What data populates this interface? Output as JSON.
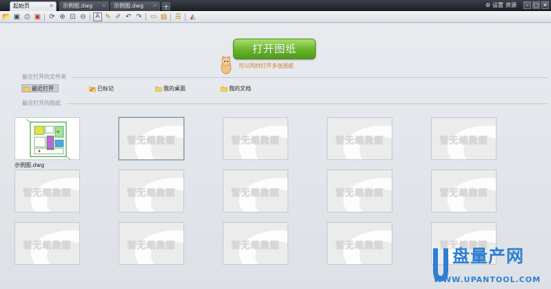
{
  "tabs": [
    {
      "label": "起始页",
      "active": true
    },
    {
      "label": "示例图.dwg",
      "active": false
    },
    {
      "label": "示例图.dwg",
      "active": false
    }
  ],
  "titlebar": {
    "settings_label": "设置",
    "resource_label": "资源",
    "new_tab_symbol": "+"
  },
  "toolbar": {
    "icons": [
      "open-folder-icon",
      "save-icon",
      "print-icon",
      "save-as-icon",
      "rotate-icon",
      "zoom-in-icon",
      "zoom-window-icon",
      "zoom-out-icon",
      "text-icon",
      "pencil-icon",
      "brush-icon",
      "undo-icon",
      "redo-icon",
      "measure-icon",
      "ruler-icon",
      "layer-icon",
      "eraser-icon"
    ]
  },
  "main": {
    "open_button_label": "打开图纸",
    "hint_text": "可以同时打开多张图纸"
  },
  "recent_folders": {
    "title": "最近打开的文件夹",
    "items": [
      {
        "label": "最近打开",
        "icon": "folder-icon",
        "selected": true
      },
      {
        "label": "已标记",
        "icon": "pencil-folder-icon",
        "selected": false
      },
      {
        "label": "我的桌面",
        "icon": "folder-icon",
        "selected": false
      },
      {
        "label": "我的文档",
        "icon": "folder-icon",
        "selected": false
      }
    ]
  },
  "recent_drawings": {
    "title": "最近打开的图纸",
    "placeholder_text": "暂无缩微图",
    "items": [
      {
        "label": "示例图.dwg",
        "has_thumbnail": true
      },
      {
        "label": "",
        "has_thumbnail": false
      },
      {
        "label": "",
        "has_thumbnail": false
      },
      {
        "label": "",
        "has_thumbnail": false
      },
      {
        "label": "",
        "has_thumbnail": false
      },
      {
        "label": "",
        "has_thumbnail": false
      },
      {
        "label": "",
        "has_thumbnail": false
      },
      {
        "label": "",
        "has_thumbnail": false
      },
      {
        "label": "",
        "has_thumbnail": false
      },
      {
        "label": "",
        "has_thumbnail": false
      },
      {
        "label": "",
        "has_thumbnail": false
      },
      {
        "label": "",
        "has_thumbnail": false
      },
      {
        "label": "",
        "has_thumbnail": false
      },
      {
        "label": "",
        "has_thumbnail": false
      },
      {
        "label": "",
        "has_thumbnail": false
      }
    ]
  },
  "watermark": {
    "brand": "盘量产网",
    "url": "WWW.UPANTOOL.COM",
    "color": "#2d7fd1"
  }
}
